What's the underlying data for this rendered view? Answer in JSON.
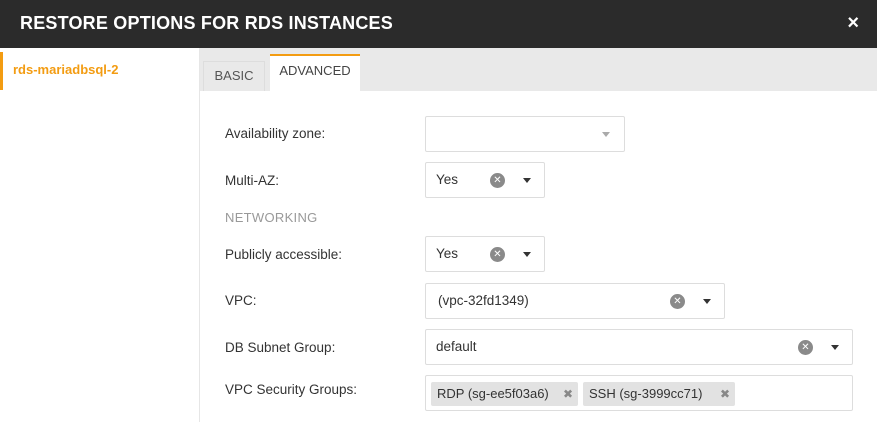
{
  "dialog": {
    "title": "RESTORE OPTIONS FOR RDS INSTANCES",
    "close_icon": "×"
  },
  "sidebar": {
    "items": [
      {
        "label": "rds-mariadbsql-2",
        "selected": true
      }
    ]
  },
  "tabs": [
    {
      "label": "BASIC",
      "active": false
    },
    {
      "label": "ADVANCED",
      "active": true
    }
  ],
  "form": {
    "availability_zone": {
      "label": "Availability zone:",
      "value": ""
    },
    "multi_az": {
      "label": "Multi-AZ:",
      "value": "Yes"
    },
    "networking_heading": "NETWORKING",
    "publicly_accessible": {
      "label": "Publicly accessible:",
      "value": "Yes"
    },
    "vpc": {
      "label": "VPC:",
      "value": "(vpc-32fd1349)"
    },
    "db_subnet_group": {
      "label": "DB Subnet Group:",
      "value": "default"
    },
    "vpc_security_groups": {
      "label": "VPC Security Groups:",
      "tags": [
        "RDP (sg-ee5f03a6)",
        "SSH (sg-3999cc71)"
      ]
    }
  },
  "colors": {
    "accent": "#f39c12",
    "titlebar": "#2b2b2b"
  }
}
